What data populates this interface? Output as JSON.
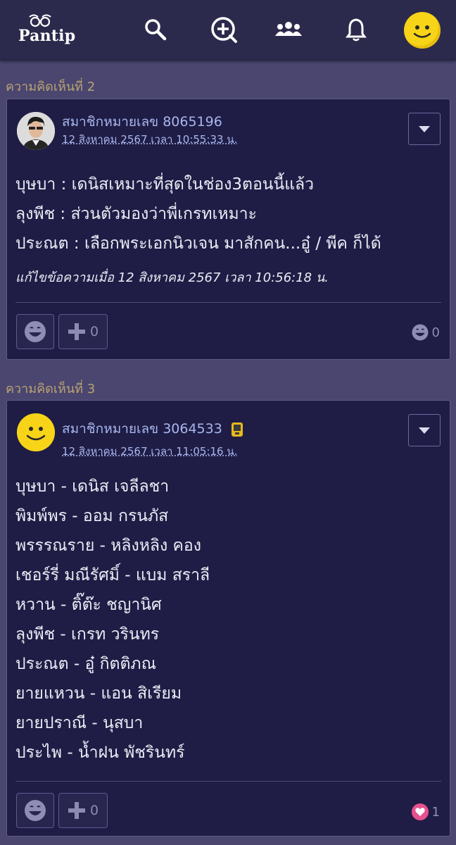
{
  "header": {
    "logo_text": "Pantip"
  },
  "comments": [
    {
      "section_label": "ความคิดเห็นที่ 2",
      "member": "สมาชิกหมายเลข 8065196",
      "timestamp": "12 สิงหาคม 2567 เวลา 10:55:33 น.",
      "lines": [
        "บุษบา : เดนิสเหมาะที่สุดในช่อง3ตอนนี้แล้ว",
        "ลุงพีช  : ส่วนตัวมองว่าพี่เกรทเหมาะ",
        "ประณต : เลือกพระเอกนิวเจน มาสักคน...อู๋ / พีค ก็ได้"
      ],
      "edit_note": "แก้ไขข้อความเมื่อ 12 สิงหาคม 2567 เวลา 10:56:18 น.",
      "plus_count": "0",
      "reaction_count": "0"
    },
    {
      "section_label": "ความคิดเห็นที่ 3",
      "member": "สมาชิกหมายเลข 3064533",
      "timestamp": "12 สิงหาคม 2567 เวลา 11:05:16 น.",
      "lines": [
        "บุษบา - เดนิส เจลีลชา",
        "พิมพ์พร - ออม กรนภัส",
        "พรรรณราย - หลิงหลิง คอง",
        "เชอร์รี่ มณีรัศมิ์ - แบม สราลี",
        "หวาน - ติ๊ต๊ะ ชญานิศ",
        "ลุงพีช - เกรท วรินทร",
        "ประณต - อู๋ กิตติภณ",
        "ยายแหวน - แอน สิเรียม",
        "ยายปราณี - นุสบา",
        "ประไพ - น้ำฝน พัชรินทร์"
      ],
      "plus_count": "0",
      "reaction_count": "1"
    }
  ],
  "colors": {
    "background": "#4a4670",
    "card": "#1f1d45",
    "link": "#a9b6ee",
    "section_label": "#b9a272",
    "heart": "#e8518f"
  }
}
